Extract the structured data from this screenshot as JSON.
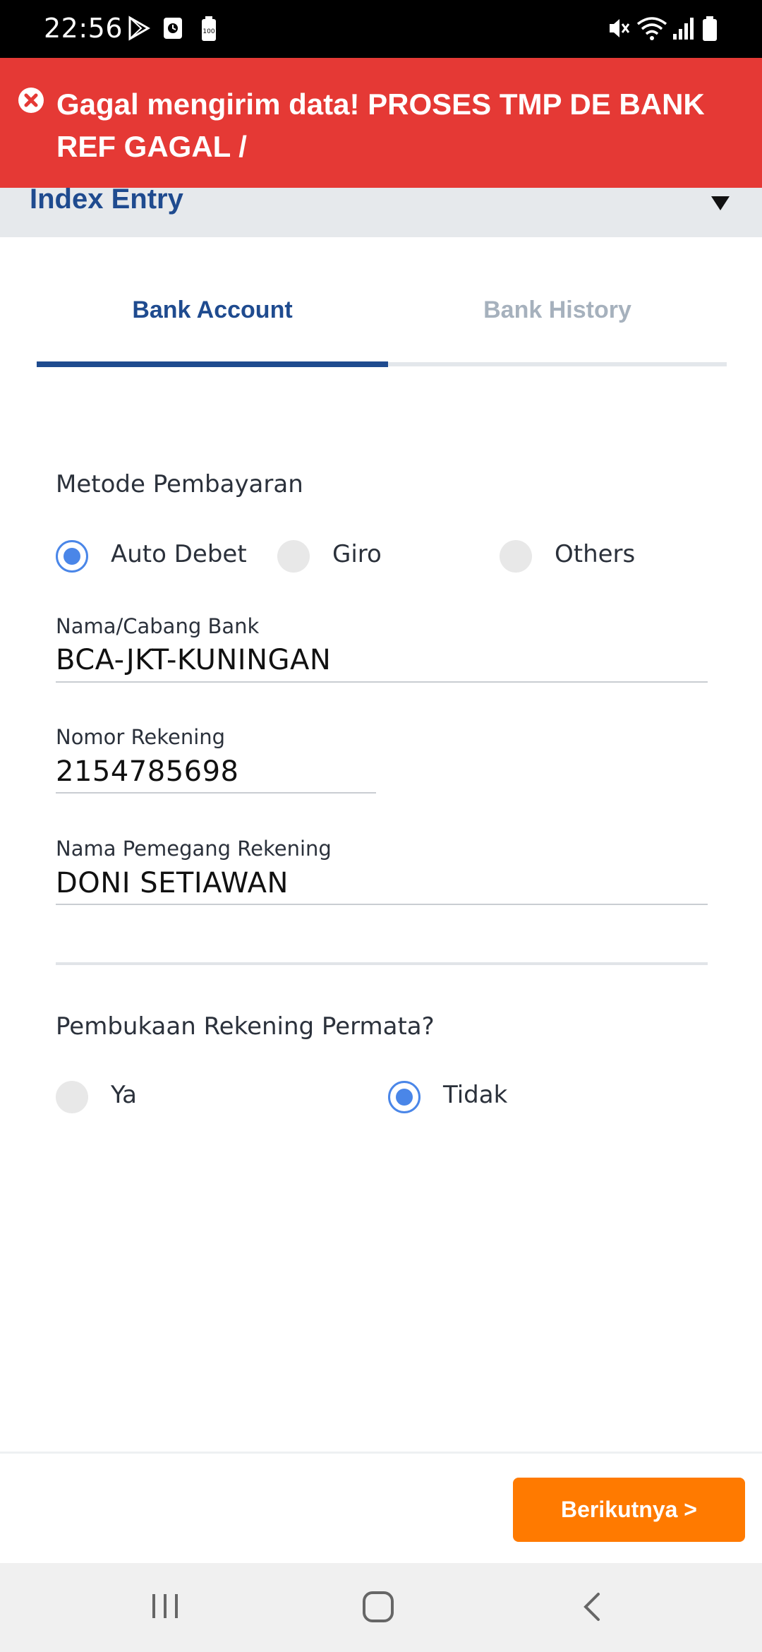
{
  "status_bar": {
    "time": "22:56",
    "icons": [
      "play-store-icon",
      "screen-icon",
      "battery-saver-icon",
      "mute-icon",
      "wifi-icon",
      "signal-icon",
      "battery-icon"
    ]
  },
  "error_banner": {
    "icon": "error-circle-icon",
    "message": "Gagal mengirim data! PROSES TMP DE BANK REF GAGAL /",
    "background": "#e53935"
  },
  "index_bar": {
    "title": "Index Entry"
  },
  "tabs": [
    {
      "label": "Bank Account",
      "active": true
    },
    {
      "label": "Bank History",
      "active": false
    }
  ],
  "payment_method": {
    "label": "Metode Pembayaran",
    "options": [
      {
        "label": "Auto Debet",
        "checked": true
      },
      {
        "label": "Giro",
        "checked": false
      },
      {
        "label": "Others",
        "checked": false
      }
    ]
  },
  "fields": {
    "bank_branch": {
      "label": "Nama/Cabang Bank",
      "value": "BCA-JKT-KUNINGAN"
    },
    "account_number": {
      "label": "Nomor Rekening",
      "value": "2154785698"
    },
    "holder_name": {
      "label": "Nama Pemegang Rekening",
      "value": "DONI SETIAWAN"
    }
  },
  "permata": {
    "label": "Pembukaan Rekening Permata?",
    "options": [
      {
        "label": "Ya",
        "checked": false
      },
      {
        "label": "Tidak",
        "checked": true
      }
    ]
  },
  "next_button": {
    "label": "Berikutnya >",
    "color": "#ff7a00"
  },
  "navbar": {
    "icons": [
      "recent-apps-icon",
      "home-icon",
      "back-icon"
    ]
  },
  "colors": {
    "accent": "#1f4b8f",
    "radio": "#4a86e8"
  }
}
